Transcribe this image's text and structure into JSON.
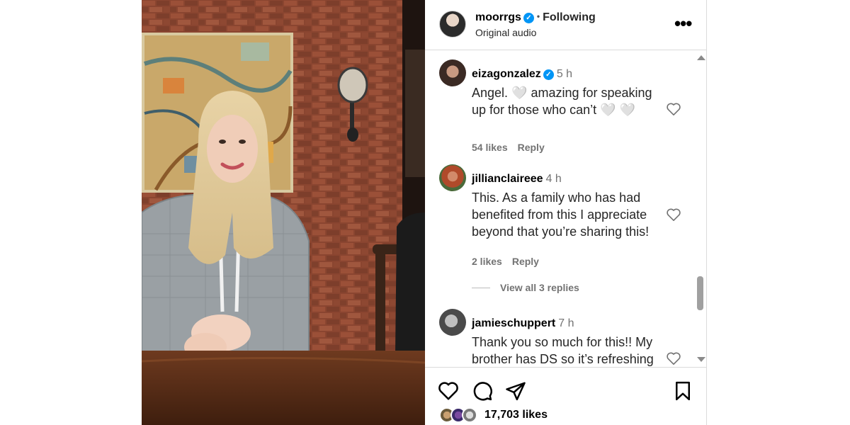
{
  "post": {
    "username": "moorrgs",
    "follow_status": "Following",
    "separator": "•",
    "audio": "Original audio",
    "more_icon": "more-horizontal-icon"
  },
  "comments": [
    {
      "username": "eizagonzalez",
      "verified": true,
      "time": "5 h",
      "text": "Angel. 🤍 amazing for speaking up for those who can’t 🤍 🤍",
      "likes": "54 likes",
      "reply": "Reply"
    },
    {
      "username": "jillianclaireee",
      "verified": false,
      "time": "4 h",
      "text": "This. As a family who has had benefited from this I appreciate beyond that you’re sharing this!",
      "likes": "2 likes",
      "reply": "Reply",
      "view_replies": "View all 3 replies"
    },
    {
      "username": "jamieschuppert",
      "verified": false,
      "time": "7 h",
      "text": "Thank you so much for this!! My brother has DS so it’s refreshing to see you speak",
      "likes": "",
      "reply": ""
    }
  ],
  "actions": {
    "icons": [
      "heart-icon",
      "comment-icon",
      "share-icon",
      "save-icon"
    ],
    "likes_count": "17,703 likes"
  },
  "colors": {
    "verified": "#0095f6",
    "muted_text": "#737373",
    "divider": "#dbdbdb",
    "brick": "#7a3b2a"
  }
}
